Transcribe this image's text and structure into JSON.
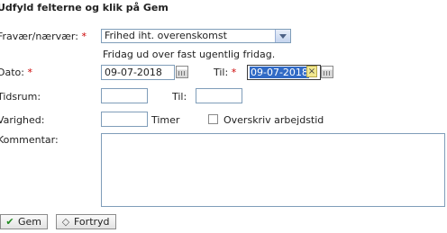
{
  "form": {
    "heading": "Udfyld felterne og klik på Gem",
    "absence": {
      "label": "Fravær/nærvær:",
      "required_mark": "*",
      "selected": "Frihed iht. overenskomst",
      "description": "Fridag ud over fast ugentlig fridag."
    },
    "date": {
      "label": "Dato:",
      "required_mark": "*",
      "from_value": "09-07-2018",
      "to_label": "Til:",
      "to_required_mark": "*",
      "to_value": "09-07-2018"
    },
    "timespan": {
      "label": "Tidsrum:",
      "from_value": "",
      "to_label": "Til:",
      "to_value": ""
    },
    "duration": {
      "label": "Varighed:",
      "value": "",
      "unit": "Timer",
      "override_label": "Overskriv arbejdstid",
      "override_checked": false
    },
    "comment": {
      "label": "Kommentar:",
      "value": ""
    }
  },
  "buttons": {
    "save_label": "Gem",
    "cancel_label": "Fortryd"
  },
  "icons": {
    "save": "check-icon",
    "cancel": "diamond-icon",
    "calendar": "calendar-icon",
    "clear": "clear-icon",
    "dropdown": "chevron-down-icon"
  }
}
